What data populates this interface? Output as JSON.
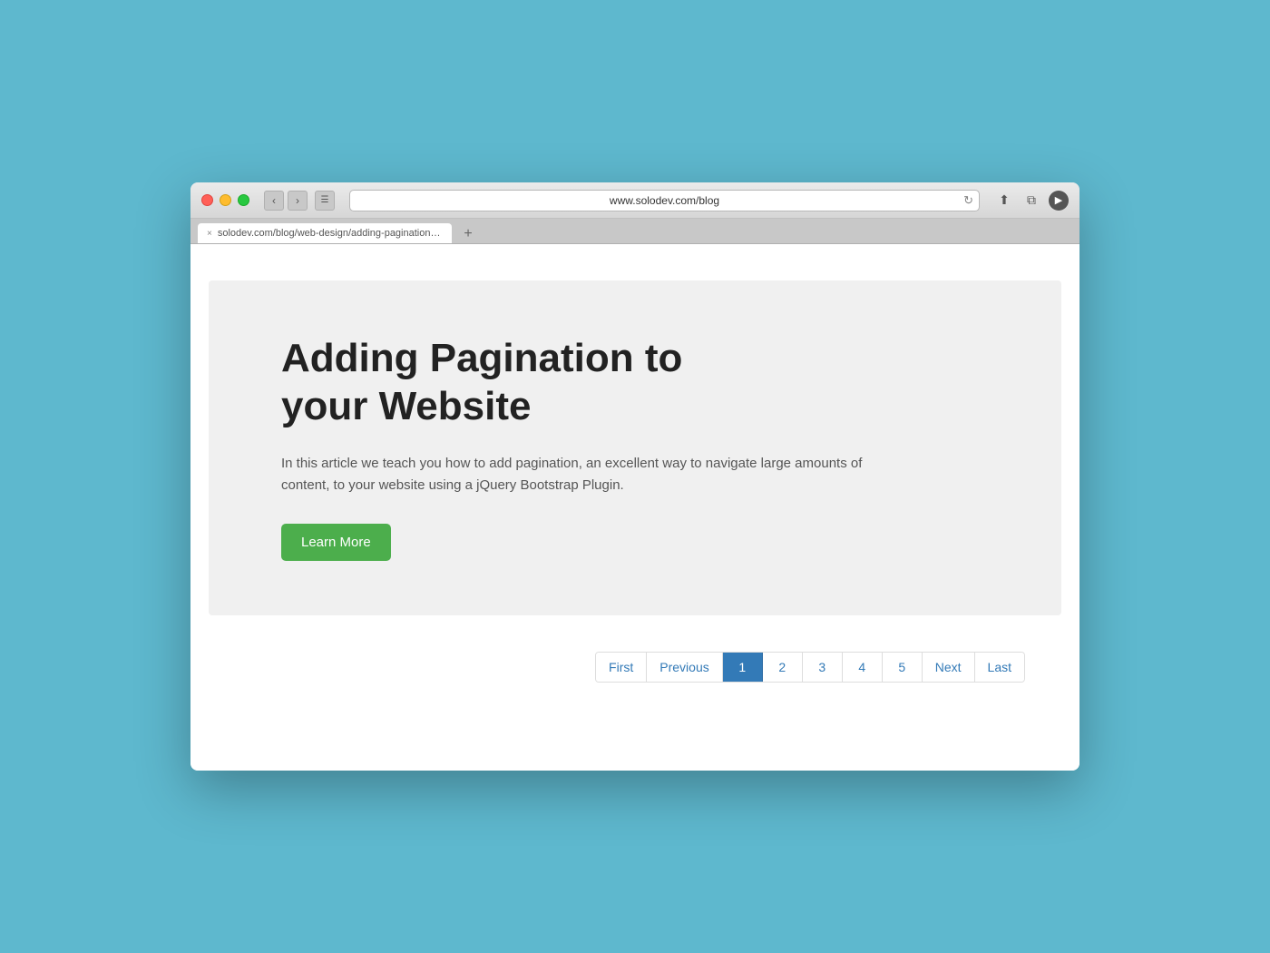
{
  "browser": {
    "url_bar": "www.solodev.com/blog",
    "tab_url": "solodev.com/blog/web-design/adding-pagination-to-your-website.stml",
    "tab_close_label": "×",
    "tab_plus_label": "+"
  },
  "hero": {
    "title": "Adding Pagination to your Website",
    "description": "In this article we teach you how to add pagination, an excellent way to navigate large amounts of content, to your website using a jQuery Bootstrap Plugin.",
    "learn_more_label": "Learn More"
  },
  "pagination": {
    "first_label": "First",
    "previous_label": "Previous",
    "pages": [
      "1",
      "2",
      "3",
      "4",
      "5"
    ],
    "active_page": "1",
    "next_label": "Next",
    "last_label": "Last"
  }
}
